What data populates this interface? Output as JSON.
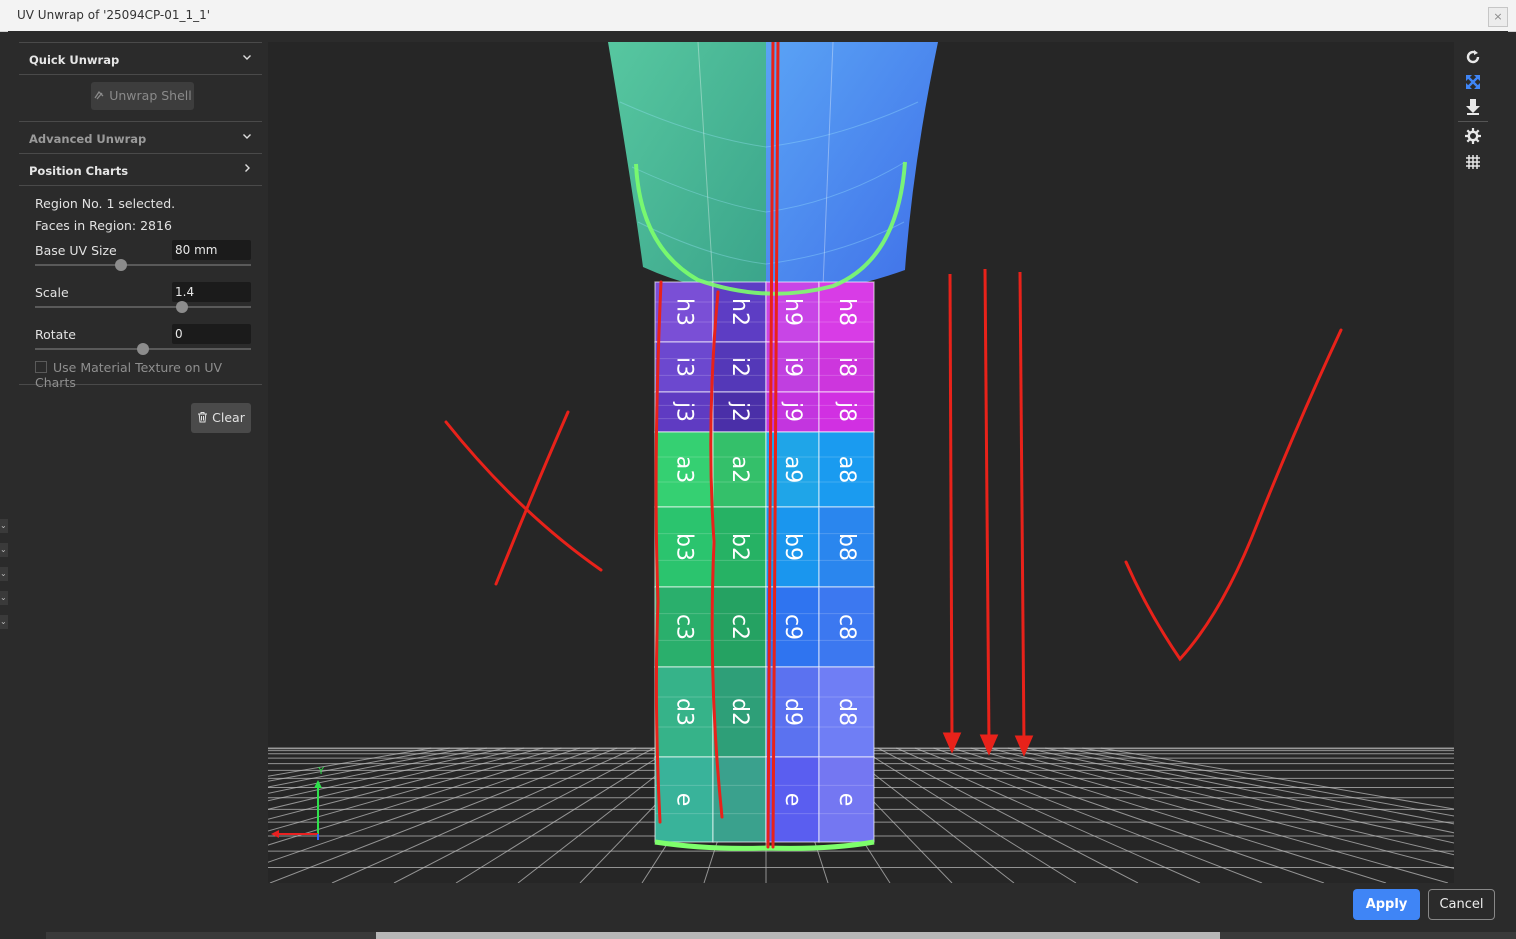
{
  "window": {
    "title": "UV Unwrap of '25094CP-01_1_1'",
    "close_glyph": "×"
  },
  "panel": {
    "quick_unwrap": {
      "label": "Quick Unwrap",
      "unwrap_shell_label": "Unwrap Shell"
    },
    "advanced_unwrap": {
      "label": "Advanced Unwrap"
    },
    "position_charts": {
      "label": "Position Charts",
      "region_text": "Region No. 1 selected.",
      "faces_text": "Faces in Region: 2816",
      "base_uv_size": {
        "label": "Base UV Size",
        "value": "80 mm",
        "slider": 0.4
      },
      "scale": {
        "label": "Scale",
        "value": "1.4",
        "slider": 0.68
      },
      "rotate": {
        "label": "Rotate",
        "value": "0",
        "slider": 0.5
      },
      "material_texture_label": "Use Material Texture on UV Charts",
      "material_texture_checked": false
    },
    "clear_label": "Clear"
  },
  "viewport": {
    "axis_labels": {
      "y": "Y"
    },
    "tiles": [
      {
        "col": 0,
        "row": 0,
        "text": "h3"
      },
      {
        "col": 1,
        "row": 0,
        "text": "h2"
      },
      {
        "col": 2,
        "row": 0,
        "text": "h9"
      },
      {
        "col": 3,
        "row": 0,
        "text": "h8"
      },
      {
        "col": 0,
        "row": 1,
        "text": "i3"
      },
      {
        "col": 1,
        "row": 1,
        "text": "i2"
      },
      {
        "col": 2,
        "row": 1,
        "text": "i9"
      },
      {
        "col": 3,
        "row": 1,
        "text": "i8"
      },
      {
        "col": 0,
        "row": 2,
        "text": "j3"
      },
      {
        "col": 1,
        "row": 2,
        "text": "j2"
      },
      {
        "col": 2,
        "row": 2,
        "text": "j9"
      },
      {
        "col": 3,
        "row": 2,
        "text": "j8"
      },
      {
        "col": 0,
        "row": 3,
        "text": "a3"
      },
      {
        "col": 1,
        "row": 3,
        "text": "a2"
      },
      {
        "col": 2,
        "row": 3,
        "text": "a9"
      },
      {
        "col": 3,
        "row": 3,
        "text": "a8"
      },
      {
        "col": 0,
        "row": 4,
        "text": "b3"
      },
      {
        "col": 1,
        "row": 4,
        "text": "b2"
      },
      {
        "col": 2,
        "row": 4,
        "text": "b9"
      },
      {
        "col": 3,
        "row": 4,
        "text": "b8"
      },
      {
        "col": 0,
        "row": 5,
        "text": "c3"
      },
      {
        "col": 1,
        "row": 5,
        "text": "c2"
      },
      {
        "col": 2,
        "row": 5,
        "text": "c9"
      },
      {
        "col": 3,
        "row": 5,
        "text": "c8"
      },
      {
        "col": 0,
        "row": 6,
        "text": "d3"
      },
      {
        "col": 1,
        "row": 6,
        "text": "d2"
      },
      {
        "col": 2,
        "row": 6,
        "text": "d9"
      },
      {
        "col": 3,
        "row": 6,
        "text": "d8"
      },
      {
        "col": 0,
        "row": 7,
        "text": "e"
      },
      {
        "col": 1,
        "row": 7,
        "text": ""
      },
      {
        "col": 2,
        "row": 7,
        "text": "e"
      },
      {
        "col": 3,
        "row": 7,
        "text": "e"
      }
    ],
    "tools": [
      "reset-view-icon",
      "fit-view-icon",
      "download-icon",
      "settings-icon",
      "grid-view-icon"
    ]
  },
  "footer": {
    "apply_label": "Apply",
    "cancel_label": "Cancel"
  },
  "colors": {
    "accent": "#3f85f6",
    "annotation": "#e8221a",
    "seam": "#7dff6b"
  }
}
